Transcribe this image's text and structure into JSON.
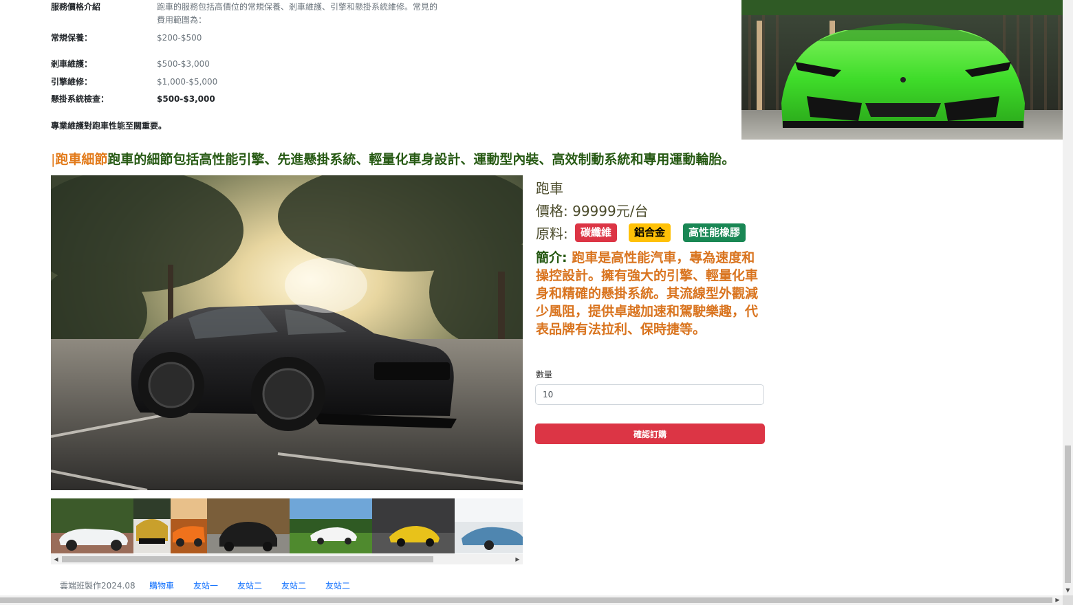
{
  "service_prices": {
    "title": "服務價格介紹",
    "intro_line1": "跑車的服務包括高價位的常規保養、剎車維護、引擎和懸掛系統維修。常見的",
    "intro_line2": "費用範圍為：",
    "rows": [
      {
        "label": "常規保養：",
        "value": "$200-$500"
      },
      {
        "label": "剎車維護：",
        "value": "$500-$3,000"
      },
      {
        "label": "引擎維修：",
        "value": "$1,000-$5,000"
      },
      {
        "label": "懸掛系統檢查：",
        "value": "$500-$3,000"
      }
    ],
    "note": "專業維護對跑車性能至關重要。"
  },
  "details": {
    "bar": "|",
    "highlight": "跑車細節",
    "text": "跑車的細節包括高性能引擎、先進懸掛系統、輕量化車身設計、運動型內裝、高效制動系統和專用運動輪胎。"
  },
  "product": {
    "name": "跑車",
    "price": "價格: 99999元/台",
    "materials_label": "原料:",
    "materials": [
      {
        "name": "碳纖維",
        "bg": "#dc3545",
        "fg": "#ffffff"
      },
      {
        "name": "鋁合金",
        "bg": "#ffc107",
        "fg": "#000000"
      },
      {
        "name": "高性能橡膠",
        "bg": "#198754",
        "fg": "#ffffff"
      }
    ],
    "intro_label": "簡介:",
    "intro_text": " 跑車是高性能汽車，專為速度和操控設計。擁有強大的引擎、輕量化車身和精確的懸掛系統。其流線型外觀減少風阻，提供卓越加速和駕駛樂趣，代表品牌有法拉利、保時捷等。"
  },
  "order": {
    "qty_label": "數量",
    "qty_value": "10",
    "confirm_label": "確認訂購"
  },
  "footer": {
    "credit": "雲端班製作2024.08",
    "links": [
      "購物車",
      "友站一",
      "友站二",
      "友站二",
      "友站二"
    ]
  },
  "colors": {
    "accent_orange": "#e27a1a",
    "heading_green": "#275a14",
    "danger": "#dc3545",
    "link": "#0d6efd"
  }
}
